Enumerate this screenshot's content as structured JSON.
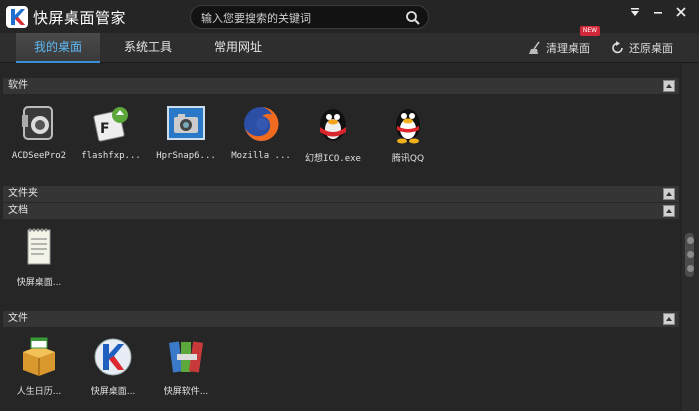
{
  "app": {
    "title": "快屏桌面管家"
  },
  "search": {
    "placeholder": "输入您要搜索的关键词"
  },
  "window": {
    "menu_glyph": "⇟",
    "minimize_glyph": "–",
    "close_glyph": "✕"
  },
  "tabs": [
    {
      "label": "我的桌面",
      "active": true
    },
    {
      "label": "系统工具",
      "active": false
    },
    {
      "label": "常用网址",
      "active": false
    }
  ],
  "actions": {
    "clean_label": "清理桌面",
    "restore_label": "还原桌面",
    "new_badge": "NEW"
  },
  "colors": {
    "accent": "#5db9f5",
    "badge": "#d3273a"
  },
  "sections": {
    "software": {
      "title": "软件",
      "items": [
        {
          "label": "ACDSeePro2",
          "icon": "speaker-icon"
        },
        {
          "label": "flashfxp...",
          "icon": "flashfxp-icon"
        },
        {
          "label": "HprSnap6...",
          "icon": "camera-icon"
        },
        {
          "label": "Mozilla ...",
          "icon": "firefox-icon"
        },
        {
          "label": "幻想ICO.exe",
          "icon": "penguin-icon"
        },
        {
          "label": "腾讯QQ",
          "icon": "qq-icon"
        }
      ]
    },
    "folders": {
      "title": "文件夹"
    },
    "documents": {
      "title": "文档",
      "items": [
        {
          "label": "快屏桌面...",
          "icon": "notepad-icon"
        }
      ]
    },
    "files": {
      "title": "文件",
      "items": [
        {
          "label": "人生日历...",
          "icon": "calendar-box-icon"
        },
        {
          "label": "快屏桌面...",
          "icon": "kuaiping-icon"
        },
        {
          "label": "快屏软件...",
          "icon": "books-icon"
        }
      ]
    }
  }
}
